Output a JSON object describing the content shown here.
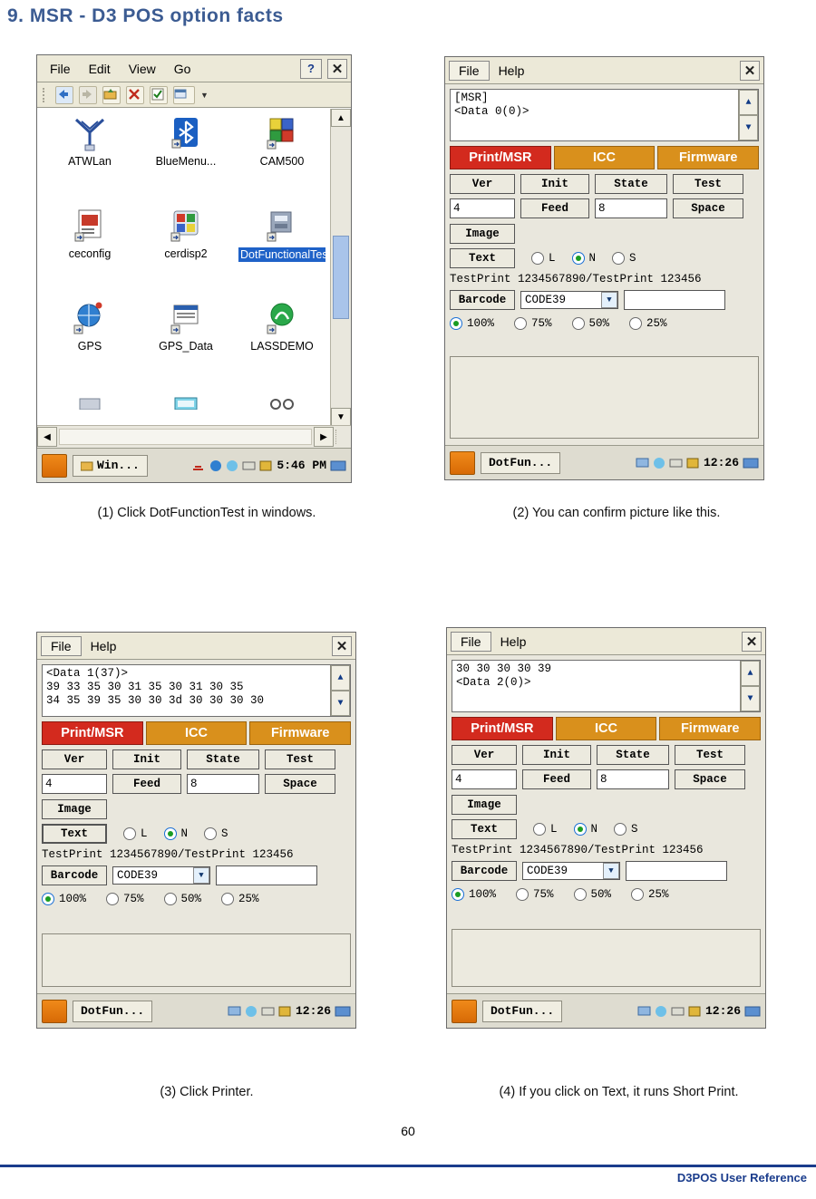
{
  "page": {
    "title": "9. MSR - D3 POS option facts",
    "number": "60",
    "footer": "D3POS User Reference"
  },
  "captions": {
    "c1": "(1) Click DotFunctionTest in windows.",
    "c2": "(2) You can confirm picture like this.",
    "c3": "(3) Click Printer.",
    "c4": "(4) If you click on Text, it runs Short Print."
  },
  "explorer": {
    "menu": [
      "File",
      "Edit",
      "View",
      "Go"
    ],
    "help_label": "?",
    "close_label": "✕",
    "icons": [
      {
        "label": "ATWLan",
        "selected": false
      },
      {
        "label": "BlueMenu...",
        "selected": false
      },
      {
        "label": "CAM500",
        "selected": false
      },
      {
        "label": "ceconfig",
        "selected": false
      },
      {
        "label": "cerdisp2",
        "selected": false
      },
      {
        "label": "DotFunctionalTest",
        "selected": true
      },
      {
        "label": "GPS",
        "selected": false
      },
      {
        "label": "GPS_Data",
        "selected": false
      },
      {
        "label": "LASSDEMO",
        "selected": false
      }
    ],
    "taskbar": {
      "task_label": "Win...",
      "clock": "5:46 PM"
    },
    "scroll": {
      "up": "▲",
      "down": "▼",
      "left": "◀",
      "right": "▶"
    }
  },
  "msr_common": {
    "menu": [
      "File",
      "Help"
    ],
    "close_label": "✕",
    "tabs": [
      {
        "label": "Print/MSR",
        "color": "#d32a1e"
      },
      {
        "label": "ICC",
        "color": "#d9901c"
      },
      {
        "label": "Firmware",
        "color": "#d9901c"
      }
    ],
    "buttons": {
      "ver": "Ver",
      "init": "Init",
      "state": "State",
      "test": "Test",
      "feed": "Feed",
      "space": "Space",
      "image": "Image",
      "text": "Text",
      "barcode": "Barcode"
    },
    "fields": {
      "feed_value": "4",
      "space_value": "8",
      "barcode_text": ""
    },
    "size_radios": [
      {
        "label": "L",
        "selected": false
      },
      {
        "label": "N",
        "selected": true
      },
      {
        "label": "S",
        "selected": false
      }
    ],
    "test_line": "TestPrint 1234567890/TestPrint 123456",
    "barcode_type": "CODE39",
    "scale_radios": [
      {
        "label": "100%",
        "selected": true
      },
      {
        "label": "75%",
        "selected": false
      },
      {
        "label": "50%",
        "selected": false
      },
      {
        "label": "25%",
        "selected": false
      }
    ],
    "taskbar": {
      "task_label": "DotFun...",
      "clock": "12:26"
    },
    "scroll": {
      "up": "▲",
      "down": "▼"
    }
  },
  "msr_windows": {
    "w2": {
      "line1": "[MSR]",
      "line2": "<Data 0(0)>",
      "line3": ""
    },
    "w3": {
      "line1": "<Data 1(37)>",
      "line2": " 39 33 35 30 31 35 30 31 30 35",
      "line3": "34 35 39 35 30 30 3d 30 30 30 30"
    },
    "w4": {
      "line1": "30 30 30 30 39",
      "line2": "<Data 2(0)>",
      "line3": ""
    }
  }
}
